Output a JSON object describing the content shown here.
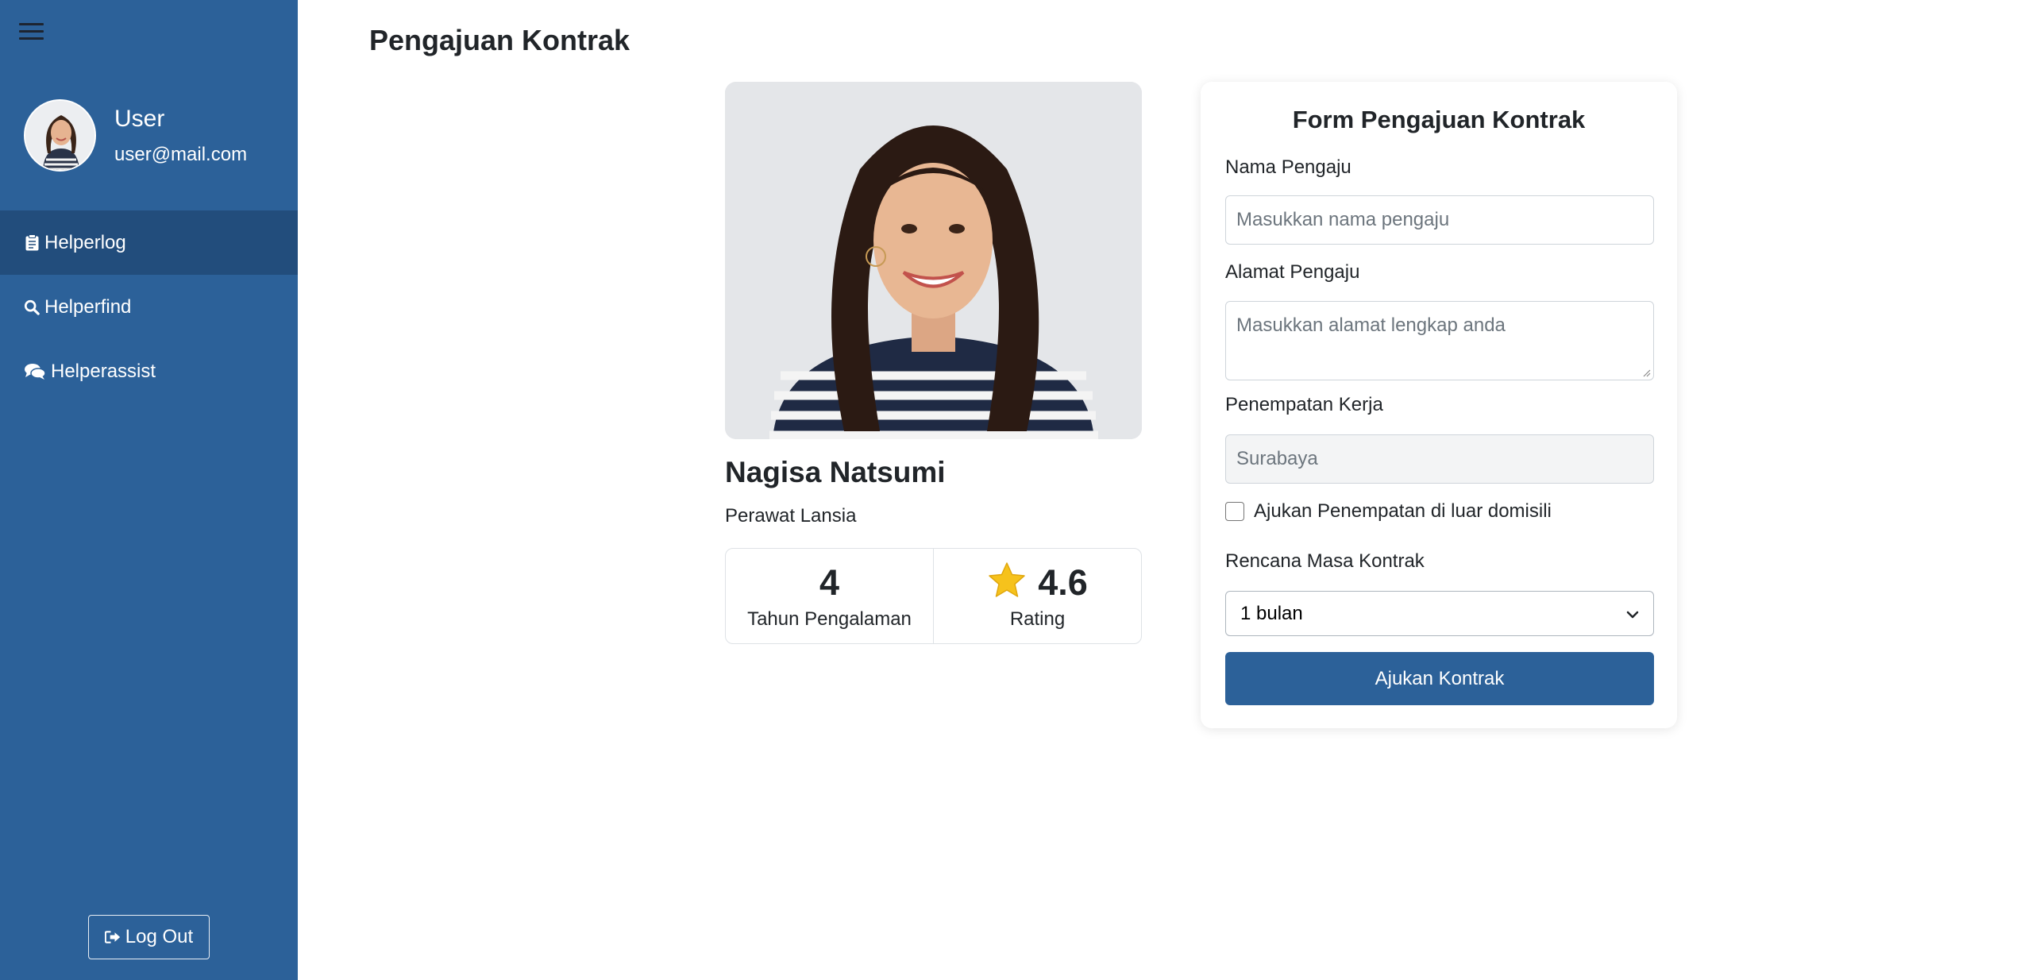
{
  "sidebar": {
    "user_name": "User",
    "user_email": "user@mail.com",
    "items": [
      {
        "label": "Helperlog",
        "icon": "clipboard-icon",
        "active": true
      },
      {
        "label": "Helperfind",
        "icon": "search-icon",
        "active": false
      },
      {
        "label": "Helperassist",
        "icon": "comments-icon",
        "active": false
      }
    ],
    "logout_label": "Log Out",
    "background_color": "#2c6199",
    "active_color": "#224d7c"
  },
  "page": {
    "title": "Pengajuan Kontrak"
  },
  "helper": {
    "name": "Nagisa Natsumi",
    "role": "Perawat Lansia",
    "experience_value": "4",
    "experience_label": "Tahun Pengalaman",
    "rating_value": "4.6",
    "rating_label": "Rating"
  },
  "form": {
    "title": "Form Pengajuan Kontrak",
    "name_label": "Nama Pengaju",
    "name_placeholder": "Masukkan nama pengaju",
    "address_label": "Alamat Pengaju",
    "address_placeholder": "Masukkan alamat lengkap anda",
    "placement_label": "Penempatan Kerja",
    "placement_value": "Surabaya",
    "outside_domicile_label": "Ajukan Penempatan di luar domisili",
    "outside_domicile_checked": false,
    "duration_label": "Rencana Masa Kontrak",
    "duration_value": "1 bulan",
    "submit_label": "Ajukan Kontrak",
    "accent_color": "#2c6199"
  }
}
